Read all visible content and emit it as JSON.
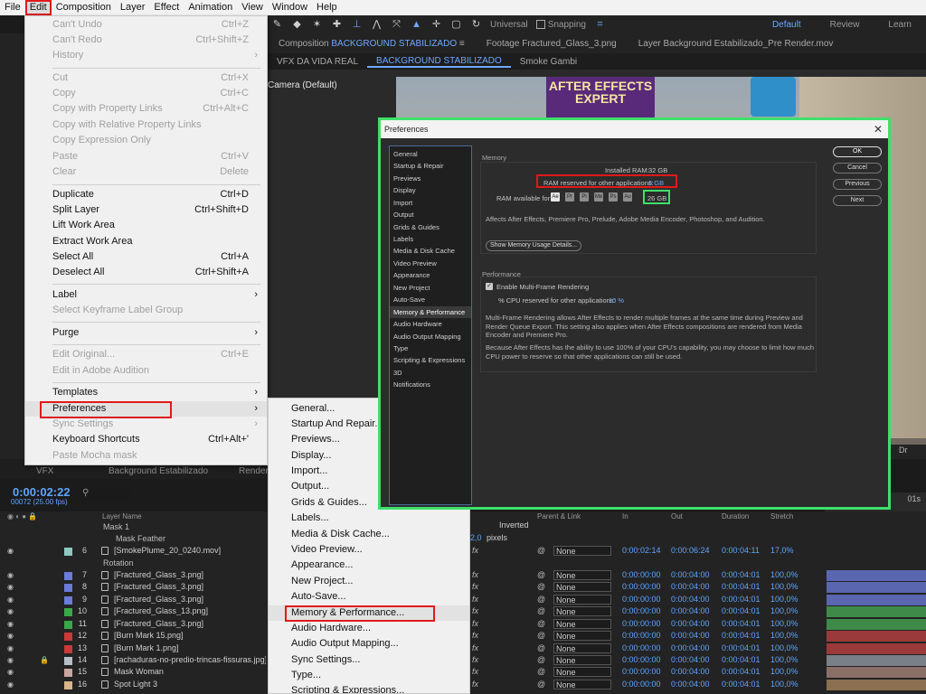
{
  "menubar": {
    "items": [
      "File",
      "Edit",
      "Composition",
      "Layer",
      "Effect",
      "Animation",
      "View",
      "Window",
      "Help"
    ]
  },
  "toolbar": {
    "universal_label": "Universal",
    "snapping_label": "Snapping",
    "workspaces": [
      "Default",
      "Review",
      "Learn"
    ]
  },
  "comp_panel": {
    "tabs": [
      {
        "prefix": "Composition",
        "name": "BACKGROUND STABILIZADO"
      },
      {
        "prefix": "Footage",
        "name": "Fractured_Glass_3.png"
      },
      {
        "prefix": "Layer",
        "name": "Background Estabilizado_Pre Render.mov"
      }
    ],
    "breadcrumbs": [
      "VFX DA VIDA REAL",
      "BACKGROUND STABILIZADO",
      "Smoke Gambi"
    ],
    "camera_label": "Camera (Default)",
    "sign_text": "AFTER EFFECTS EXPERT"
  },
  "edit_menu": {
    "items": [
      {
        "label": "Can't Undo",
        "shortcut": "Ctrl+Z",
        "disabled": true
      },
      {
        "label": "Can't Redo",
        "shortcut": "Ctrl+Shift+Z",
        "disabled": true
      },
      {
        "label": "History",
        "shortcut": "",
        "disabled": true,
        "submenu": true
      },
      {
        "label": "Cut",
        "shortcut": "Ctrl+X",
        "disabled": true
      },
      {
        "label": "Copy",
        "shortcut": "Ctrl+C",
        "disabled": true
      },
      {
        "label": "Copy with Property Links",
        "shortcut": "Ctrl+Alt+C",
        "disabled": true
      },
      {
        "label": "Copy with Relative Property Links",
        "shortcut": "",
        "disabled": true
      },
      {
        "label": "Copy Expression Only",
        "shortcut": "",
        "disabled": true
      },
      {
        "label": "Paste",
        "shortcut": "Ctrl+V",
        "disabled": true
      },
      {
        "label": "Clear",
        "shortcut": "Delete",
        "disabled": true
      },
      {
        "label": "Duplicate",
        "shortcut": "Ctrl+D",
        "disabled": false
      },
      {
        "label": "Split Layer",
        "shortcut": "Ctrl+Shift+D",
        "disabled": false
      },
      {
        "label": "Lift Work Area",
        "shortcut": "",
        "disabled": false
      },
      {
        "label": "Extract Work Area",
        "shortcut": "",
        "disabled": false
      },
      {
        "label": "Select All",
        "shortcut": "Ctrl+A",
        "disabled": false
      },
      {
        "label": "Deselect All",
        "shortcut": "Ctrl+Shift+A",
        "disabled": false
      },
      {
        "label": "Label",
        "shortcut": "",
        "disabled": false,
        "submenu": true
      },
      {
        "label": "Select Keyframe Label Group",
        "shortcut": "",
        "disabled": true
      },
      {
        "label": "Purge",
        "shortcut": "",
        "disabled": false,
        "submenu": true
      },
      {
        "label": "Edit Original...",
        "shortcut": "Ctrl+E",
        "disabled": true
      },
      {
        "label": "Edit in Adobe Audition",
        "shortcut": "",
        "disabled": true
      },
      {
        "label": "Templates",
        "shortcut": "",
        "disabled": false,
        "submenu": true
      },
      {
        "label": "Preferences",
        "shortcut": "",
        "disabled": false,
        "submenu": true
      },
      {
        "label": "Sync Settings",
        "shortcut": "",
        "disabled": true,
        "submenu": true
      },
      {
        "label": "Keyboard Shortcuts",
        "shortcut": "Ctrl+Alt+'",
        "disabled": false
      },
      {
        "label": "Paste Mocha mask",
        "shortcut": "",
        "disabled": true
      }
    ]
  },
  "prefs_submenu": {
    "items": [
      "General...",
      "Startup And Repair...",
      "Previews...",
      "Display...",
      "Import...",
      "Output...",
      "Grids & Guides...",
      "Labels...",
      "Media & Disk Cache...",
      "Video Preview...",
      "Appearance...",
      "New Project...",
      "Auto-Save...",
      "Memory & Performance...",
      "Audio Hardware...",
      "Audio Output Mapping...",
      "Sync Settings...",
      "Type...",
      "Scripting & Expressions..."
    ]
  },
  "pref_dialog": {
    "title": "Preferences",
    "close_glyph": "✕",
    "nav": [
      "General",
      "Startup & Repair",
      "Previews",
      "Display",
      "Import",
      "Output",
      "Grids & Guides",
      "Labels",
      "Media & Disk Cache",
      "Video Preview",
      "Appearance",
      "New Project",
      "Auto-Save",
      "Memory & Performance",
      "Audio Hardware",
      "Audio Output Mapping",
      "Type",
      "Scripting & Expressions",
      "3D",
      "Notifications"
    ],
    "selected_nav": "Memory & Performance",
    "memory": {
      "group_title": "Memory",
      "installed_label": "Installed RAM:",
      "installed_value": "32 GB",
      "reserved_label": "RAM reserved for other applications:",
      "reserved_value": "6 GB",
      "available_label": "RAM available for",
      "app_icons": [
        "Ae",
        "Pr",
        "Pl",
        "Me",
        "Ps",
        "Au"
      ],
      "available_value": "26 GB",
      "note": "Affects After Effects, Premiere Pro, Prelude, Adobe Media Encoder, Photoshop, and Audition.",
      "details_button": "Show Memory Usage Details..."
    },
    "performance": {
      "group_title": "Performance",
      "mfr_label": "Enable Multi-Frame Rendering",
      "cpu_label": "% CPU reserved for other applications:",
      "cpu_value": "10 %",
      "para1": "Multi-Frame Rendering allows After Effects to render multiple frames at the same time during Preview and Render Queue Export. This setting also applies when After Effects compositions are rendered from Media Encoder and Premiere Pro.",
      "para2": "Because After Effects has the ability to use 100% of your CPU's capability, you may choose to limit how much CPU power to reserve so that other applications can still be used."
    },
    "buttons": [
      "OK",
      "Cancel",
      "Previous",
      "Next"
    ]
  },
  "timeline": {
    "tabs": [
      "VFX",
      "Background Estabilizado",
      "Render"
    ],
    "timecode": "0:00:02:22",
    "fps": "00072 (25.00 fps)",
    "search_glyph": "⚲",
    "col_layer_name": "Layer Name",
    "col_parent": "Parent & Link",
    "col_in": "In",
    "col_out": "Out",
    "col_duration": "Duration",
    "col_stretch": "Stretch",
    "ruler_label": "01s",
    "right_panel_label": "Dr",
    "extra_inverted": "Inverted",
    "extra_pixels": "pixels",
    "extra_value": "2,0",
    "rows": [
      {
        "name": "Mask 1",
        "sub": true
      },
      {
        "name": "Mask Feather",
        "sub": true,
        "indent": true
      },
      {
        "num": "6",
        "name": "[SmokePlume_20_0240.mov]",
        "color": "#8fc7c0",
        "in": "0:00:02:14",
        "out": "0:00:06:24",
        "dur": "0:00:04:11",
        "stretch": "17,0%",
        "parent": "None"
      },
      {
        "name": "Rotation",
        "sub": true
      },
      {
        "num": "7",
        "name": "[Fractured_Glass_3.png]",
        "color": "#6a7bd8",
        "in": "0:00:00:00",
        "out": "0:00:04:00",
        "dur": "0:00:04:01",
        "stretch": "100,0%",
        "parent": "None",
        "bar": "#5a66b0"
      },
      {
        "num": "8",
        "name": "[Fractured_Glass_3.png]",
        "color": "#6a7bd8",
        "in": "0:00:00:00",
        "out": "0:00:04:00",
        "dur": "0:00:04:01",
        "stretch": "100,0%",
        "parent": "None",
        "bar": "#5a66b0"
      },
      {
        "num": "9",
        "name": "[Fractured_Glass_3.png]",
        "color": "#6a7bd8",
        "in": "0:00:00:00",
        "out": "0:00:04:00",
        "dur": "0:00:04:01",
        "stretch": "100,0%",
        "parent": "None",
        "bar": "#5a66b0"
      },
      {
        "num": "10",
        "name": "[Fractured_Glass_13.png]",
        "color": "#3aa84a",
        "in": "0:00:00:00",
        "out": "0:00:04:00",
        "dur": "0:00:04:01",
        "stretch": "100,0%",
        "parent": "None",
        "bar": "#3f8a48"
      },
      {
        "num": "11",
        "name": "[Fractured_Glass_3.png]",
        "color": "#3aa84a",
        "in": "0:00:00:00",
        "out": "0:00:04:00",
        "dur": "0:00:04:01",
        "stretch": "100,0%",
        "parent": "None",
        "bar": "#3f8a48"
      },
      {
        "num": "12",
        "name": "[Burn Mark 15.png]",
        "color": "#c83a3a",
        "in": "0:00:00:00",
        "out": "0:00:04:00",
        "dur": "0:00:04:01",
        "stretch": "100,0%",
        "parent": "None",
        "bar": "#9a3a3a"
      },
      {
        "num": "13",
        "name": "[Burn Mark 1.png]",
        "color": "#c83a3a",
        "in": "0:00:00:00",
        "out": "0:00:04:00",
        "dur": "0:00:04:01",
        "stretch": "100,0%",
        "parent": "None",
        "bar": "#9a3a3a"
      },
      {
        "num": "14",
        "name": "[rachaduras-no-predio-trincas-fissuras.jpg]",
        "color": "#b7c0c8",
        "in": "0:00:00:00",
        "out": "0:00:04:00",
        "dur": "0:00:04:01",
        "stretch": "100,0%",
        "parent": "None",
        "bar": "#7a8088"
      },
      {
        "num": "15",
        "name": "Mask Woman",
        "color": "#c9a6a0",
        "in": "0:00:00:00",
        "out": "0:00:04:00",
        "dur": "0:00:04:01",
        "stretch": "100,0%",
        "parent": "None",
        "bar": "#8a6e68"
      },
      {
        "num": "16",
        "name": "Spot Light 3",
        "color": "#d9b38a",
        "in": "0:00:00:00",
        "out": "0:00:04:00",
        "dur": "0:00:04:01",
        "stretch": "100,0%",
        "parent": "None",
        "bar": "#8a7050"
      }
    ]
  }
}
